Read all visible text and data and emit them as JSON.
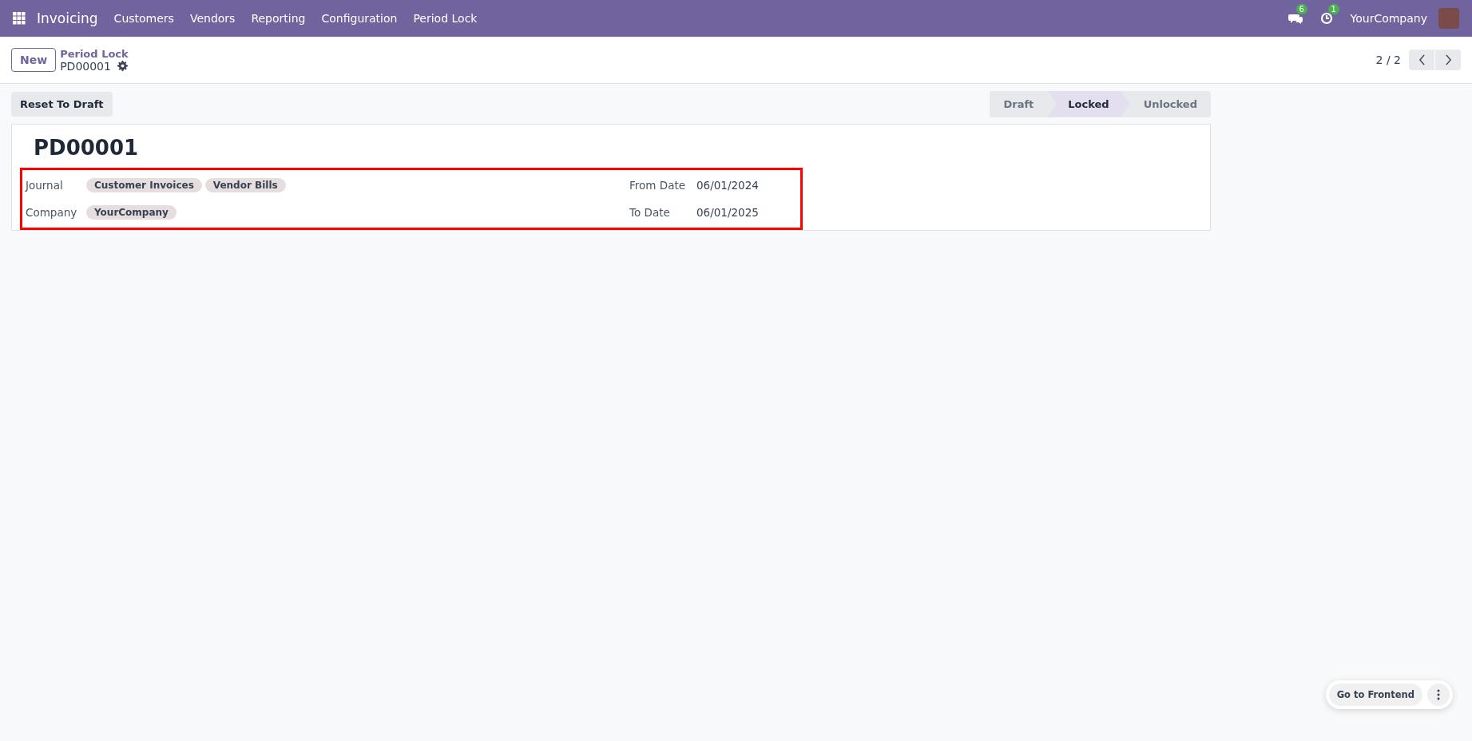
{
  "navbar": {
    "app": "Invoicing",
    "menu": [
      "Customers",
      "Vendors",
      "Reporting",
      "Configuration",
      "Period Lock"
    ],
    "messages_badge": "6",
    "activities_badge": "1",
    "company": "YourCompany"
  },
  "control_panel": {
    "new_button": "New",
    "breadcrumb": "Period Lock",
    "record": "PD00001",
    "pager": "2 / 2"
  },
  "actions": [
    "Reset To Draft"
  ],
  "statusbar": [
    {
      "label": "Draft",
      "selected": false
    },
    {
      "label": "Locked",
      "selected": true
    },
    {
      "label": "Unlocked",
      "selected": false
    }
  ],
  "form": {
    "title": "PD00001",
    "left_fields": [
      {
        "label": "Journal",
        "tags": [
          "Customer Invoices",
          "Vendor Bills"
        ]
      },
      {
        "label": "Company",
        "tags": [
          "YourCompany"
        ]
      }
    ],
    "right_fields": [
      {
        "label": "From Date",
        "value": "06/01/2024"
      },
      {
        "label": "To Date",
        "value": "06/01/2025"
      }
    ]
  },
  "floating": {
    "button": "Go to Frontend"
  }
}
